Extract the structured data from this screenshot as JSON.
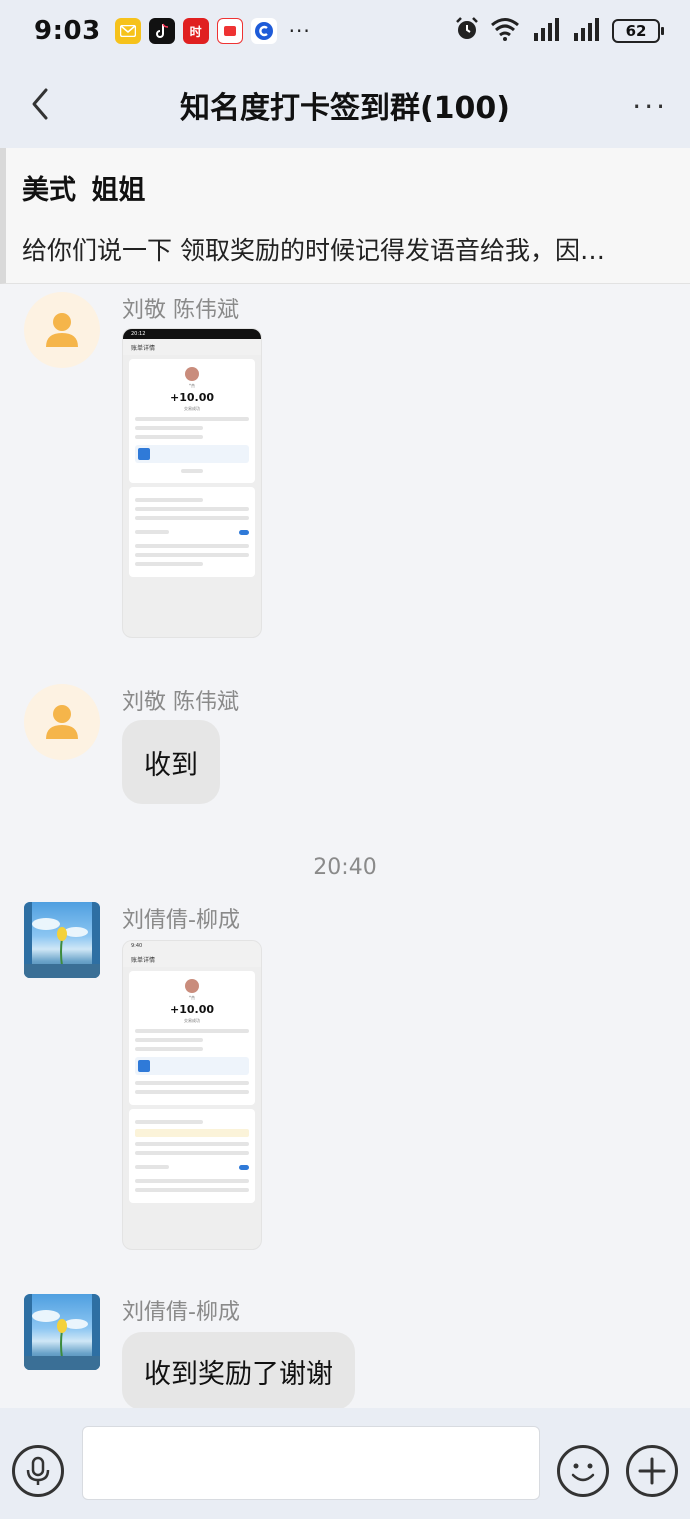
{
  "status_bar": {
    "time": "9:03",
    "battery": "62",
    "app_icons": [
      "mail-app-icon",
      "tiktok-app-icon",
      "news-app-icon",
      "coupon-app-icon",
      "browser-app-icon"
    ],
    "app_icon_labels": [
      "",
      "",
      "时",
      "",
      ""
    ],
    "overflow": "···"
  },
  "header": {
    "title": "知名度打卡签到群(100)",
    "more": "···"
  },
  "pinned": {
    "sender": "美式 姐姐",
    "text": "给你们说一下 领取奖励的时候记得发语音给我，因…"
  },
  "messages": [
    {
      "sender": "刘敬 陈伟斌",
      "type": "image",
      "receipt": {
        "status_time": "20:12",
        "nav_title": "账单详情",
        "payer": "*杰",
        "amount": "+10.00",
        "result": "交易成功"
      }
    },
    {
      "sender": "刘敬 陈伟斌",
      "type": "text",
      "text": "收到"
    },
    {
      "sender": "刘倩倩-柳成",
      "type": "image",
      "receipt": {
        "status_time": "9:40",
        "nav_title": "账单详情",
        "payer": "*杰",
        "amount": "+10.00",
        "result": "交易成功"
      }
    },
    {
      "sender": "刘倩倩-柳成",
      "type": "text",
      "text": "收到奖励了谢谢"
    }
  ],
  "timestamp": "20:40",
  "input_bar": {
    "placeholder": "",
    "value": ""
  },
  "colors": {
    "bar_bg": "#e9edf4",
    "chat_bg": "#f3f4f7",
    "bubble_bg": "#e6e6e6",
    "avatar_default_bg": "#fdf2e2",
    "avatar_default_icon": "#f5b54a",
    "muted_text": "#8a8a8a"
  }
}
